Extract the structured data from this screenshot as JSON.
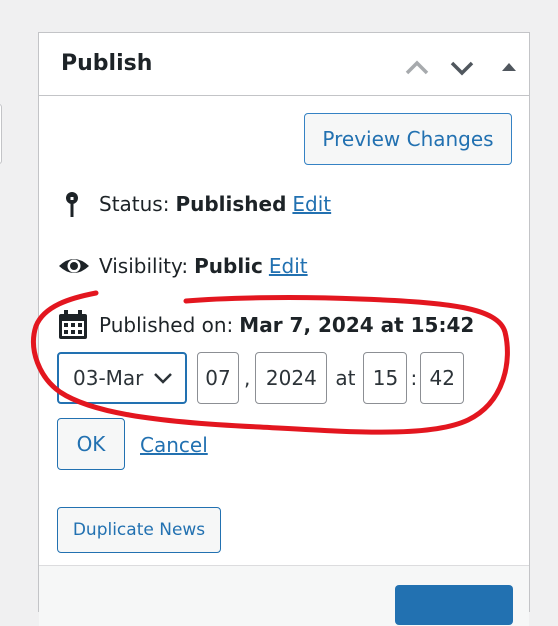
{
  "panel": {
    "title": "Publish",
    "preview_button": "Preview Changes",
    "status": {
      "label": "Status:",
      "value": "Published",
      "edit": "Edit"
    },
    "visibility": {
      "label": "Visibility:",
      "value": "Public",
      "edit": "Edit"
    },
    "published_on": {
      "label": "Published on:",
      "value": "Mar 7, 2024 at 15:42"
    },
    "date_editor": {
      "month": "03-Mar",
      "day": "07",
      "comma": ",",
      "year": "2024",
      "at": "at",
      "hour": "15",
      "colon": ":",
      "minute": "42"
    },
    "ok_button": "OK",
    "cancel_link": "Cancel",
    "duplicate_button": "Duplicate News"
  },
  "colors": {
    "link": "#2271b1",
    "annotation": "#e3161f",
    "primary_button": "#2271b1"
  },
  "icons": {
    "status": "pin-icon",
    "visibility": "eye-icon",
    "published_on": "calendar-icon",
    "header": [
      "chevron-up-icon",
      "chevron-down-icon",
      "triangle-up-icon"
    ]
  }
}
